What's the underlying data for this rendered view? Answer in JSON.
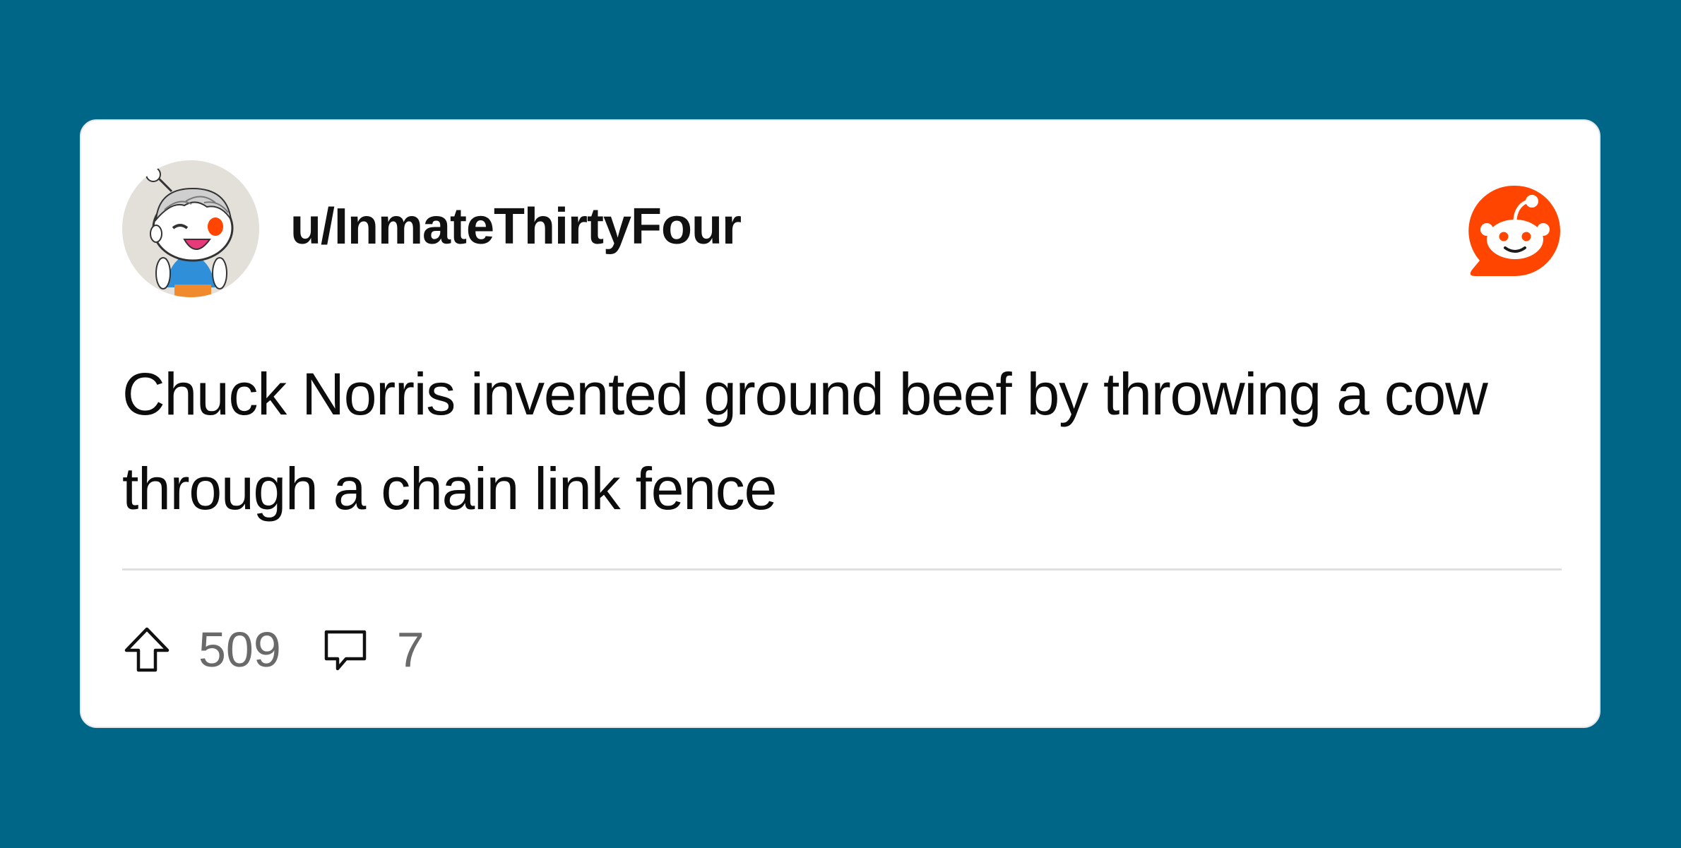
{
  "post": {
    "username": "u/InmateThirtyFour",
    "body": "Chuck Norris invented ground beef by throwing a cow through a chain link fence",
    "upvotes": "509",
    "comments": "7"
  },
  "icons": {
    "avatar": "snoo-avatar",
    "brand": "reddit-logo-icon",
    "upvote": "upvote-arrow-icon",
    "comment": "comment-bubble-icon"
  },
  "colors": {
    "background": "#006687",
    "card": "#ffffff",
    "brand": "#ff4500",
    "text": "#0c0c0c",
    "muted": "#6a6a6a"
  }
}
